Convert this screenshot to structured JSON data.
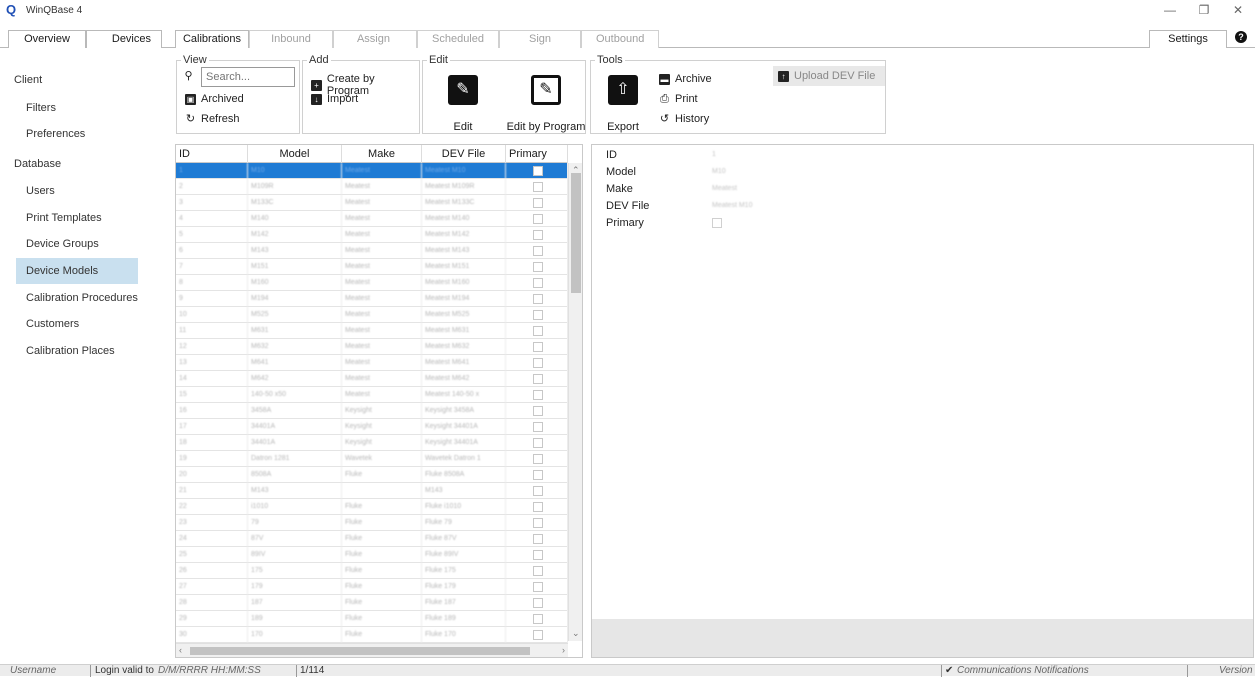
{
  "window": {
    "title": "WinQBase 4",
    "icon": "q-logo-icon"
  },
  "tabs": {
    "overview": "Overview",
    "devices": "Devices",
    "calibrations": "Calibrations",
    "inbound": "Inbound",
    "assign": "Assign",
    "scheduled": "Scheduled",
    "sign": "Sign",
    "outbound": "Outbound",
    "settings": "Settings"
  },
  "sidebar": {
    "client": "Client",
    "filters": "Filters",
    "preferences": "Preferences",
    "database": "Database",
    "users": "Users",
    "print_templates": "Print Templates",
    "device_groups": "Device Groups",
    "device_models": "Device Models",
    "calibration_procedures": "Calibration Procedures",
    "customers": "Customers",
    "calibration_places": "Calibration Places"
  },
  "toolbar": {
    "view": {
      "label": "View",
      "search_placeholder": "Search...",
      "archived": "Archived",
      "refresh": "Refresh"
    },
    "add": {
      "label": "Add",
      "create_by_program": "Create by Program",
      "import": "Import"
    },
    "edit": {
      "label": "Edit",
      "edit": "Edit",
      "edit_by_program": "Edit by Program"
    },
    "tools": {
      "label": "Tools",
      "export": "Export",
      "archive": "Archive",
      "print": "Print",
      "history": "History",
      "upload_dev_file": "Upload DEV File"
    }
  },
  "table": {
    "headers": {
      "id": "ID",
      "model": "Model",
      "make": "Make",
      "dev_file": "DEV File",
      "primary": "Primary"
    },
    "rows": [
      {
        "id": "1",
        "model": "M10",
        "make": "Meatest",
        "dev": "Meatest M10"
      },
      {
        "id": "2",
        "model": "M109R",
        "make": "Meatest",
        "dev": "Meatest M109R"
      },
      {
        "id": "3",
        "model": "M133C",
        "make": "Meatest",
        "dev": "Meatest M133C"
      },
      {
        "id": "4",
        "model": "M140",
        "make": "Meatest",
        "dev": "Meatest M140"
      },
      {
        "id": "5",
        "model": "M142",
        "make": "Meatest",
        "dev": "Meatest M142"
      },
      {
        "id": "6",
        "model": "M143",
        "make": "Meatest",
        "dev": "Meatest M143"
      },
      {
        "id": "7",
        "model": "M151",
        "make": "Meatest",
        "dev": "Meatest M151"
      },
      {
        "id": "8",
        "model": "M160",
        "make": "Meatest",
        "dev": "Meatest M160"
      },
      {
        "id": "9",
        "model": "M194",
        "make": "Meatest",
        "dev": "Meatest M194"
      },
      {
        "id": "10",
        "model": "M525",
        "make": "Meatest",
        "dev": "Meatest M525"
      },
      {
        "id": "11",
        "model": "M631",
        "make": "Meatest",
        "dev": "Meatest M631"
      },
      {
        "id": "12",
        "model": "M632",
        "make": "Meatest",
        "dev": "Meatest M632"
      },
      {
        "id": "13",
        "model": "M641",
        "make": "Meatest",
        "dev": "Meatest M641"
      },
      {
        "id": "14",
        "model": "M642",
        "make": "Meatest",
        "dev": "Meatest M642"
      },
      {
        "id": "15",
        "model": "140-50 x50",
        "make": "Meatest",
        "dev": "Meatest 140-50 x"
      },
      {
        "id": "16",
        "model": "3458A",
        "make": "Keysight",
        "dev": "Keysight 3458A"
      },
      {
        "id": "17",
        "model": "34401A",
        "make": "Keysight",
        "dev": "Keysight 34401A"
      },
      {
        "id": "18",
        "model": "34401A",
        "make": "Keysight",
        "dev": "Keysight 34401A"
      },
      {
        "id": "19",
        "model": "Datron 1281",
        "make": "Wavetek",
        "dev": "Wavetek Datron 1"
      },
      {
        "id": "20",
        "model": "8508A",
        "make": "Fluke",
        "dev": "Fluke 8508A"
      },
      {
        "id": "21",
        "model": "M143",
        "make": "",
        "dev": "M143"
      },
      {
        "id": "22",
        "model": "i1010",
        "make": "Fluke",
        "dev": "Fluke i1010"
      },
      {
        "id": "23",
        "model": "79",
        "make": "Fluke",
        "dev": "Fluke 79"
      },
      {
        "id": "24",
        "model": "87V",
        "make": "Fluke",
        "dev": "Fluke 87V"
      },
      {
        "id": "25",
        "model": "89IV",
        "make": "Fluke",
        "dev": "Fluke 89IV"
      },
      {
        "id": "26",
        "model": "175",
        "make": "Fluke",
        "dev": "Fluke 175"
      },
      {
        "id": "27",
        "model": "179",
        "make": "Fluke",
        "dev": "Fluke 179"
      },
      {
        "id": "28",
        "model": "187",
        "make": "Fluke",
        "dev": "Fluke 187"
      },
      {
        "id": "29",
        "model": "189",
        "make": "Fluke",
        "dev": "Fluke 189"
      },
      {
        "id": "30",
        "model": "170",
        "make": "Fluke",
        "dev": "Fluke 170"
      }
    ]
  },
  "detail": {
    "labels": {
      "id": "ID",
      "model": "Model",
      "make": "Make",
      "dev_file": "DEV File",
      "primary": "Primary"
    },
    "values": {
      "id": "1",
      "model": "M10",
      "make": "Meatest",
      "dev_file": "Meatest M10"
    }
  },
  "status": {
    "username": "Username",
    "login_valid": "Login valid to",
    "login_format": "D/M/RRRR HH:MM:SS",
    "count": "1/114",
    "notifications": "Communications Notifications",
    "version": "Version"
  }
}
